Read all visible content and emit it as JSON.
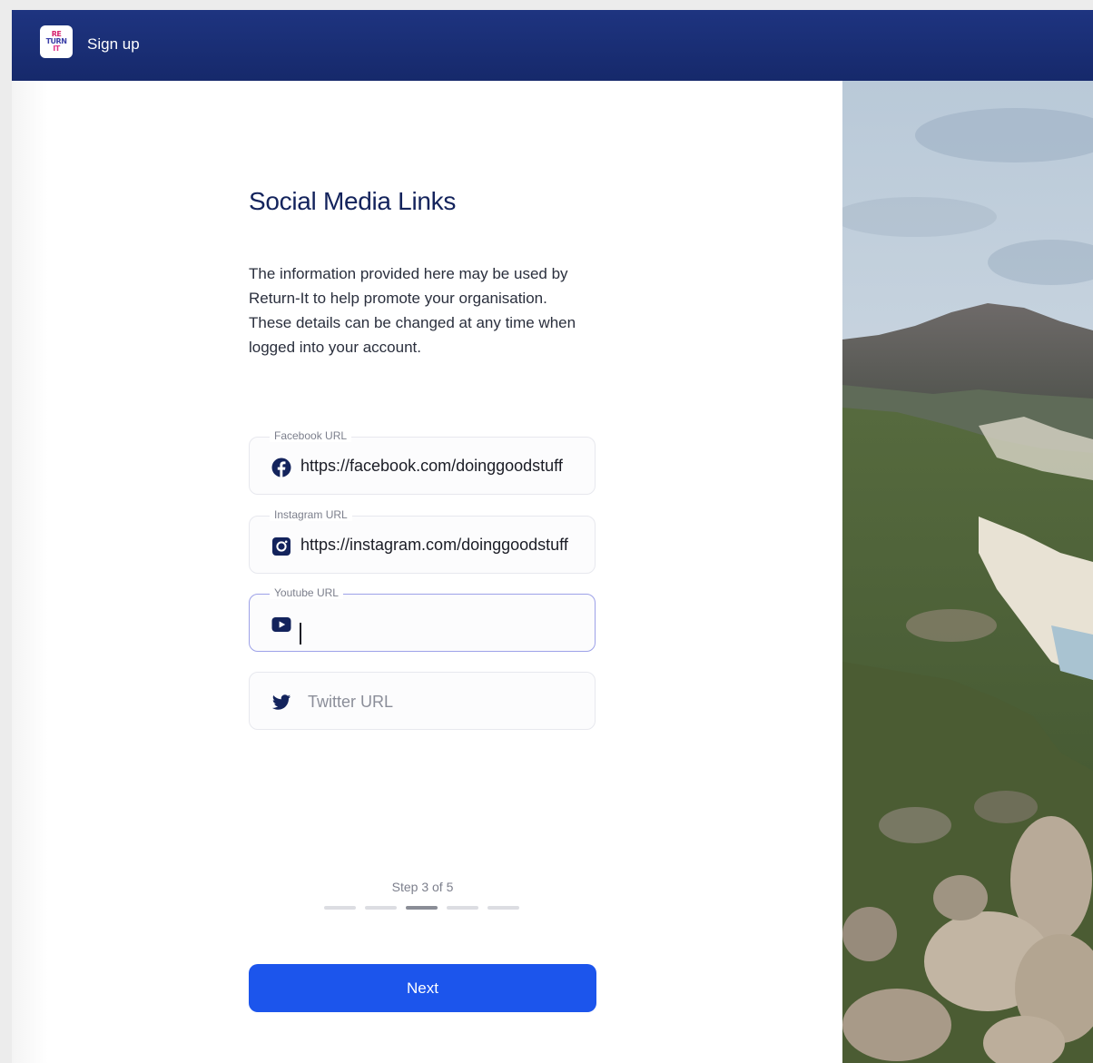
{
  "topbar": {
    "title": "Sign up",
    "logo_lines": [
      "RE",
      "TURN",
      "IT"
    ]
  },
  "heading": "Social Media Links",
  "description": "The information provided here may be used by Return-It to help promote your organisation. These details can be changed at any time when logged into your account.",
  "fields": {
    "facebook": {
      "label": "Facebook URL",
      "value": "https://facebook.com/doinggoodstuff",
      "icon": "facebook-icon"
    },
    "instagram": {
      "label": "Instagram URL",
      "value": "https://instagram.com/doinggoodstuff",
      "icon": "instagram-icon"
    },
    "youtube": {
      "label": "Youtube URL",
      "value": "",
      "icon": "youtube-icon"
    },
    "twitter": {
      "placeholder": "Twitter URL",
      "icon": "twitter-icon"
    }
  },
  "step": {
    "text": "Step 3 of 5",
    "current": 3,
    "total": 5
  },
  "next_label": "Next",
  "colors": {
    "topbar": "#1e3480",
    "primary": "#1c55ec",
    "heading": "#13235c",
    "focus_border": "#9da1e8"
  }
}
